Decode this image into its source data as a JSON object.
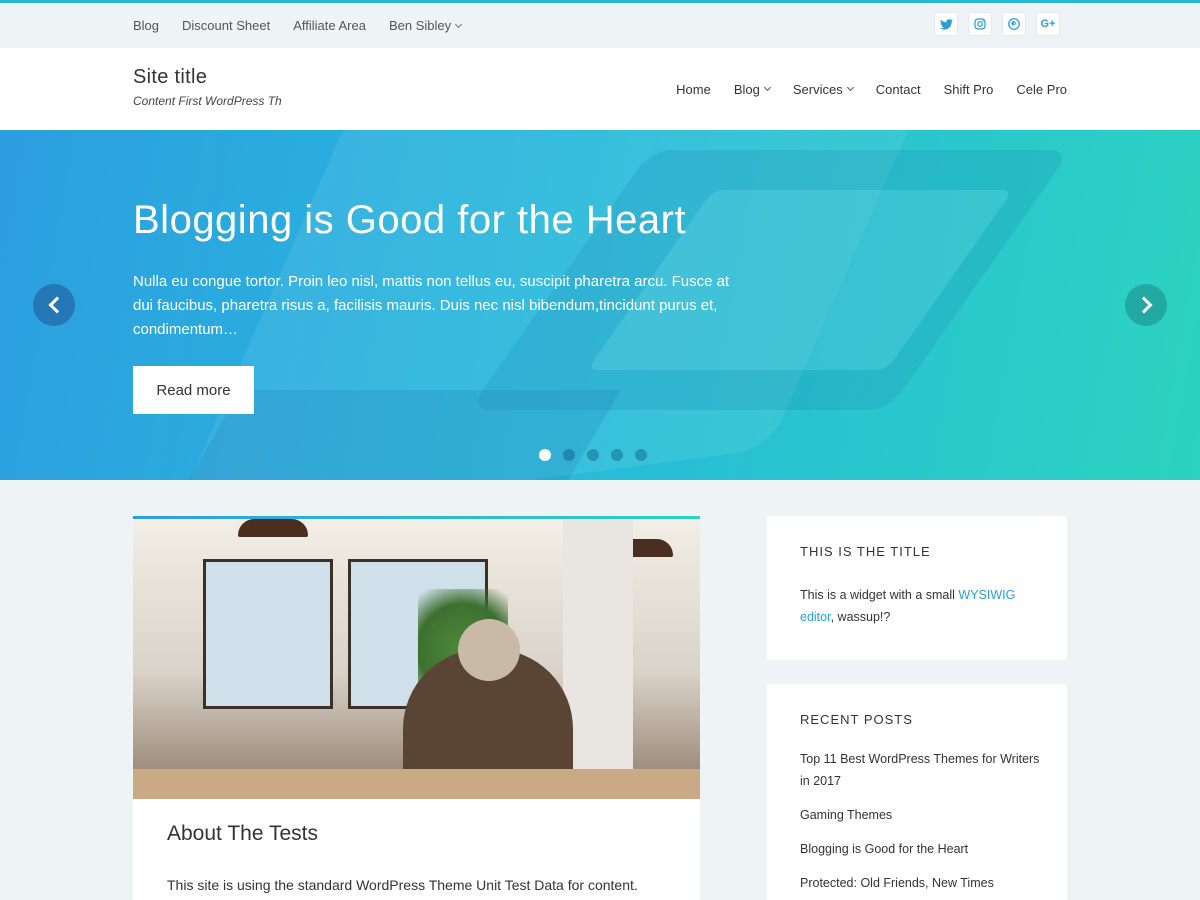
{
  "topbar": {
    "links": [
      "Blog",
      "Discount Sheet",
      "Affiliate Area",
      "Ben Sibley"
    ],
    "social_icons": [
      "twitter-icon",
      "instagram-icon",
      "pinterest-icon",
      "google-plus-icon"
    ],
    "gplus_glyph": "G+"
  },
  "header": {
    "site_title": "Site title",
    "tagline": "Content First WordPress Th",
    "nav": [
      "Home",
      "Blog",
      "Services",
      "Contact",
      "Shift Pro",
      "Cele Pro"
    ]
  },
  "hero": {
    "title": "Blogging is Good for the Heart",
    "text": "Nulla eu congue tortor. Proin leo nisl, mattis non tellus eu, suscipit pharetra arcu. Fusce at dui faucibus, pharetra risus a, facilisis mauris. Duis nec nisl bibendum,tincidunt purus et, condimentum…",
    "button": "Read more",
    "slide_count": 5,
    "active_slide": 1
  },
  "post": {
    "title": "About The Tests",
    "excerpt": "This site is using the standard WordPress Theme Unit Test Data for content."
  },
  "widget_text": {
    "title": "THIS IS THE TITLE",
    "before": "This is a widget with a small ",
    "link": "WYSIWIG editor",
    "after": ", wassup!?"
  },
  "recent_posts": {
    "title": "RECENT POSTS",
    "items": [
      "Top 11 Best WordPress Themes for Writers in 2017",
      "Gaming Themes",
      "Blogging is Good for the Heart",
      "Protected: Old Friends, New Times"
    ]
  },
  "colors": {
    "accent": "#2ab7d4",
    "link": "#2aa0d2",
    "hero_start": "#2d9ee0",
    "hero_end": "#2cd3c0"
  }
}
